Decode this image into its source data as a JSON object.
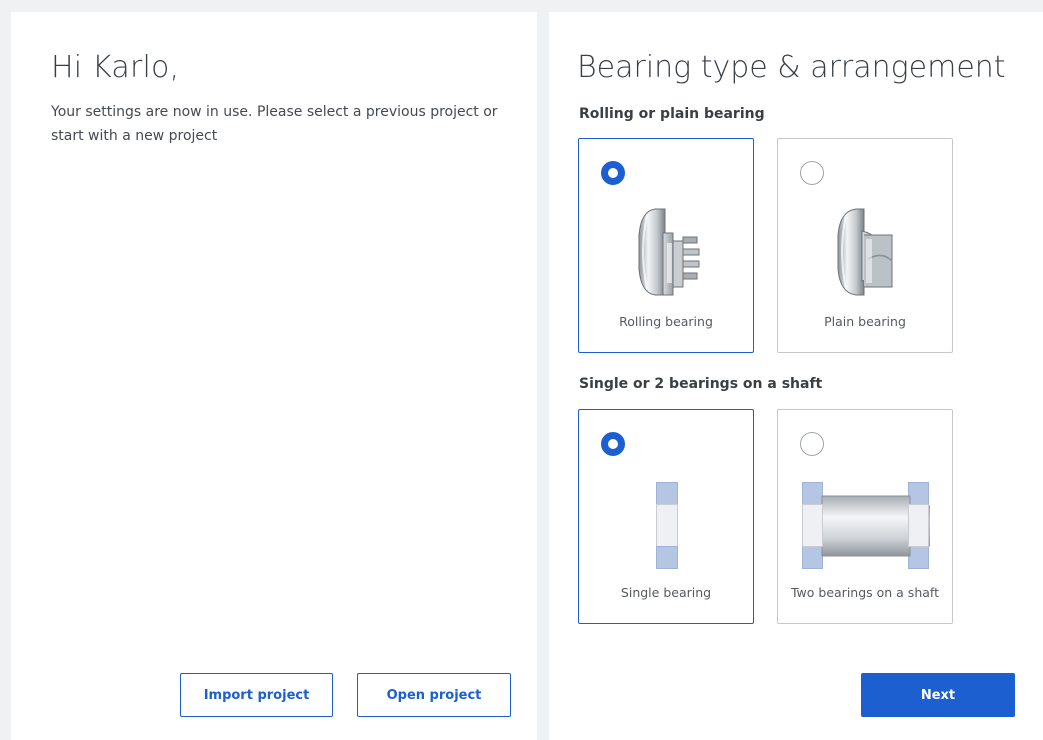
{
  "left": {
    "greeting": "Hi Karlo,",
    "intro": "Your settings are now in use. Please select a previous project or start with a new project",
    "import_label": "Import project",
    "open_label": "Open project"
  },
  "right": {
    "title": "Bearing type & arrangement",
    "groups": [
      {
        "label": "Rolling or plain bearing",
        "options": [
          {
            "label": "Rolling bearing",
            "selected": true,
            "icon": "rolling-bearing-icon"
          },
          {
            "label": "Plain bearing",
            "selected": false,
            "icon": "plain-bearing-icon"
          }
        ]
      },
      {
        "label": "Single or 2 bearings on a shaft",
        "options": [
          {
            "label": "Single bearing",
            "selected": true,
            "icon": "single-bearing-icon"
          },
          {
            "label": "Two bearings on a shaft",
            "selected": false,
            "icon": "two-bearings-shaft-icon"
          }
        ]
      }
    ],
    "next_label": "Next"
  },
  "colors": {
    "accent": "#1b5fd1",
    "background": "#f0f1f3",
    "card_border": "#c4c8cc",
    "bearing_blue": "#b4c6e4"
  }
}
